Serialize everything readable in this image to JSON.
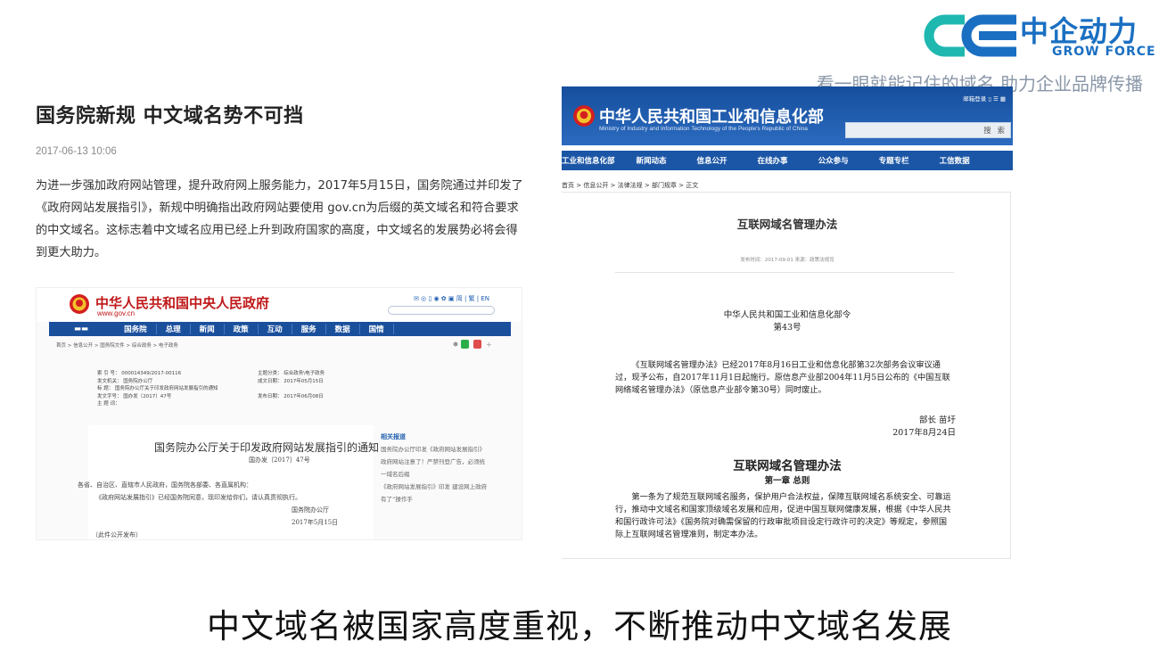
{
  "brand": {
    "name_cn": "中企动力",
    "name_en": "GROW FORCE",
    "tagline": "看一眼就能记住的域名 助力企业品牌传播",
    "accent_color": "#1a6fc2",
    "logo_icon": "ce-logo-icon"
  },
  "article": {
    "title": "国务院新规 中文域名势不可挡",
    "date": "2017-06-13 10:06",
    "body": "为进一步强加政府网站管理，提升政府网上服务能力，2017年5月15日，国务院通过并印发了《政府网站发展指引》，新规中明确指出政府网站要使用 gov.cn为后缀的英文域名和符合要求的中文域名。这标志着中文域名应用已经上升到政府国家的高度，中文域名的发展势必将会得到更大助力。"
  },
  "gov_screenshot": {
    "site_name": "中华人民共和国中央人民政府",
    "site_url": "www.gov.cn",
    "top_tools": "✉ ◎ ▯ ◉ ✿ ▣ 简 | 繁 | EN",
    "nav": [
      "国务院",
      "总理",
      "新闻",
      "政策",
      "互动",
      "服务",
      "数据",
      "国情"
    ],
    "breadcrumb": "首页 > 信息公开 > 国务院文件 > 综合政务 > 电子政务",
    "info": [
      [
        "索 引 号：  000014349/2017-00116",
        "主题分类：  综合政务\\电子政务"
      ],
      [
        "发文机关：  国务院办公厅",
        "成文日期：  2017年05月15日"
      ],
      [
        "标    题：  国务院办公厅关于印发政府网站发展指引的通知",
        ""
      ],
      [
        "发文字号：  国办发〔2017〕47号",
        "发布日期：  2017年06月08日"
      ],
      [
        "主 题 词：",
        ""
      ]
    ],
    "doc_title": "国务院办公厅关于印发政府网站发展指引的通知",
    "doc_number": "国办发〔2017〕47号",
    "doc_lines": [
      "各省、自治区、直辖市人民政府，国务院各部委、各直属机构：",
      "《政府网站发展指引》已经国务院同意，现印发给你们，请认真贯彻执行。",
      "国务院办公厅",
      "2017年5月15日",
      "（此件公开发布）"
    ],
    "related_title": "相关报道",
    "related_items": [
      "国务院办公厅印发《政府网站发展指引》",
      "政府网站注意了！严禁刊登广告，必须统一域名后缀",
      "《政府网站发展指引》印发 建设网上政府有了“操作手"
    ]
  },
  "miit_screenshot": {
    "site_name": "中华人民共和国工业和信息化部",
    "site_name_en": "Ministry of Industry and Information Technology of the People's Republic of China",
    "top_links": "邮箱登录 ▯ ☰ ▦",
    "search_button": "搜 索",
    "nav": [
      "工业和信息化部",
      "新闻动态",
      "信息公开",
      "在线办事",
      "公众参与",
      "专题专栏",
      "工信数据"
    ],
    "breadcrumb": "首页 > 信息公开 > 法律法规 > 部门规章 > 正文",
    "title": "互联网域名管理办法",
    "meta": "发布时间：2017-09-01  来源：政策法规司",
    "order_issuer": "中华人民共和国工业和信息化部令",
    "order_number": "第43号",
    "paragraph": "《互联网域名管理办法》已经2017年8月16日工业和信息化部第32次部务会议审议通过，现予公布，自2017年11月1日起施行。原信息产业部2004年11月5日公布的《中国互联网络域名管理办法》（原信息产业部令第30号）同时废止。",
    "signer": "部长  苗圩",
    "sign_date": "2017年8月24日",
    "law_title": "互联网域名管理办法",
    "chapter": "第一章 总则",
    "article_1": "第一条为了规范互联网域名服务，保护用户合法权益，保障互联网域名系统安全、可靠运行，推动中文域名和国家顶级域名发展和应用，促进中国互联网健康发展，根据《中华人民共和国行政许可法》《国务院对确需保留的行政审批项目设定行政许可的决定》等规定，参照国际上互联网域名管理准则，制定本办法。"
  },
  "caption": "中文域名被国家高度重视，不断推动中文域名发展"
}
